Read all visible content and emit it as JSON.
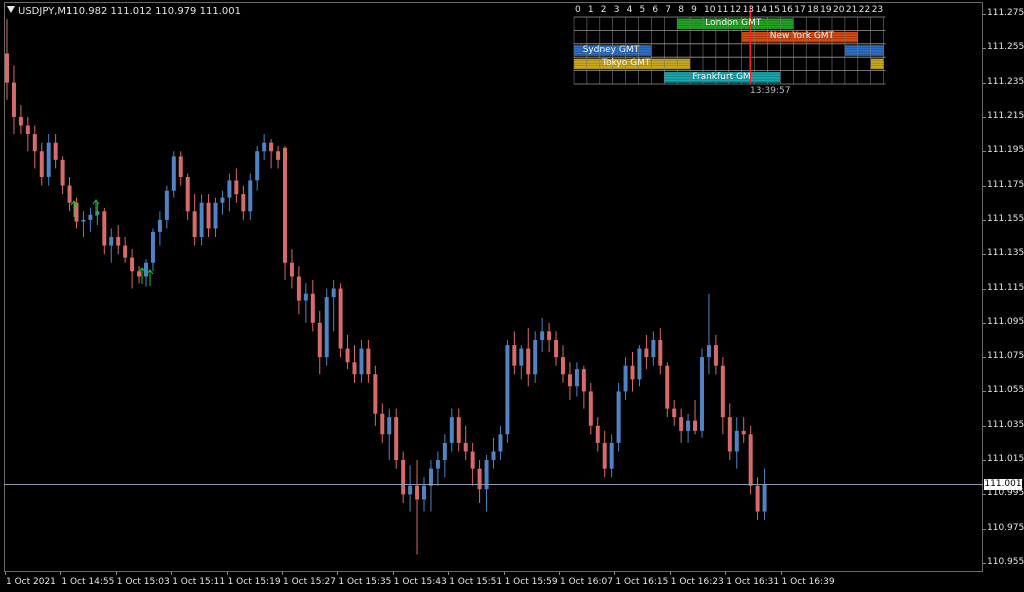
{
  "chart": {
    "symbol": "USDJPY,M1",
    "ohlc": "110.982 111.012 110.979 111.001",
    "current_price": "111.001",
    "price_labels": [
      "111.275",
      "111.255",
      "111.235",
      "111.215",
      "111.195",
      "111.175",
      "111.155",
      "111.135",
      "111.115",
      "111.095",
      "111.075",
      "111.055",
      "111.035",
      "111.015",
      "110.995",
      "110.975",
      "110.955"
    ],
    "time_labels": [
      "1 Oct 2021",
      "1 Oct 14:55",
      "1 Oct 15:03",
      "1 Oct 15:11",
      "1 Oct 15:19",
      "1 Oct 15:27",
      "1 Oct 15:35",
      "1 Oct 15:43",
      "1 Oct 15:51",
      "1 Oct 15:59",
      "1 Oct 16:07",
      "1 Oct 16:15",
      "1 Oct 16:23",
      "1 Oct 16:31",
      "1 Oct 16:39"
    ],
    "colors": {
      "bull": "#4f84c4",
      "bear": "#d96a6a",
      "bid_line": "#8c9ab0",
      "arrow": "#22c322"
    }
  },
  "sessions": {
    "hours": [
      "0",
      "1",
      "2",
      "3",
      "4",
      "5",
      "6",
      "7",
      "8",
      "9",
      "10",
      "11",
      "12",
      "13",
      "14",
      "15",
      "16",
      "17",
      "18",
      "19",
      "20",
      "21",
      "22",
      "23"
    ],
    "rows": [
      {
        "name": "London GMT",
        "color": "#1fa51f",
        "ranges": [
          [
            8,
            17
          ]
        ]
      },
      {
        "name": "New York GMT",
        "color": "#d34a12",
        "ranges": [
          [
            13,
            22
          ]
        ]
      },
      {
        "name": "Sydney GMT",
        "color": "#2d6fc4",
        "ranges": [
          [
            0,
            6
          ],
          [
            21,
            24
          ]
        ]
      },
      {
        "name": "Tokyo GMT",
        "color": "#c9a820",
        "ranges": [
          [
            0,
            9
          ],
          [
            23,
            24
          ]
        ]
      },
      {
        "name": "Frankfurt GM",
        "color": "#17a8b0",
        "ranges": [
          [
            7,
            16
          ]
        ]
      }
    ],
    "server_time": "13:39:57",
    "now_hour": 13.66
  },
  "candles": [
    [
      111.252,
      111.272,
      111.225,
      111.235
    ],
    [
      111.235,
      111.245,
      111.205,
      111.215
    ],
    [
      111.215,
      111.222,
      111.205,
      111.21
    ],
    [
      111.21,
      111.215,
      111.195,
      111.205
    ],
    [
      111.205,
      111.21,
      111.185,
      111.195
    ],
    [
      111.195,
      111.2,
      111.175,
      111.18
    ],
    [
      111.18,
      111.205,
      111.175,
      111.2
    ],
    [
      111.2,
      111.205,
      111.185,
      111.19
    ],
    [
      111.19,
      111.192,
      111.17,
      111.175
    ],
    [
      111.175,
      111.18,
      111.16,
      111.165
    ],
    [
      111.165,
      111.168,
      111.15,
      111.154
    ],
    [
      111.154,
      111.16,
      111.145,
      111.155
    ],
    [
      111.155,
      111.162,
      111.148,
      111.158
    ],
    [
      111.158,
      111.165,
      111.152,
      111.16
    ],
    [
      111.16,
      111.162,
      111.135,
      111.14
    ],
    [
      111.14,
      111.15,
      111.13,
      111.145
    ],
    [
      111.145,
      111.152,
      111.135,
      111.14
    ],
    [
      111.14,
      111.145,
      111.13,
      111.133
    ],
    [
      111.133,
      111.138,
      111.115,
      111.125
    ],
    [
      111.125,
      111.128,
      111.118,
      111.122
    ],
    [
      111.122,
      111.132,
      111.116,
      111.13
    ],
    [
      111.13,
      111.15,
      111.125,
      111.148
    ],
    [
      111.148,
      111.16,
      111.14,
      111.155
    ],
    [
      111.155,
      111.175,
      111.15,
      111.172
    ],
    [
      111.172,
      111.195,
      111.168,
      111.192
    ],
    [
      111.192,
      111.195,
      111.175,
      111.18
    ],
    [
      111.18,
      111.182,
      111.155,
      111.16
    ],
    [
      111.16,
      111.17,
      111.14,
      111.145
    ],
    [
      111.145,
      111.17,
      111.14,
      111.165
    ],
    [
      111.165,
      111.17,
      111.145,
      111.15
    ],
    [
      111.15,
      111.168,
      111.145,
      111.165
    ],
    [
      111.165,
      111.172,
      111.158,
      111.168
    ],
    [
      111.168,
      111.182,
      111.16,
      111.178
    ],
    [
      111.178,
      111.185,
      111.165,
      111.17
    ],
    [
      111.17,
      111.175,
      111.155,
      111.16
    ],
    [
      111.16,
      111.182,
      111.155,
      111.178
    ],
    [
      111.178,
      111.198,
      111.172,
      111.195
    ],
    [
      111.195,
      111.205,
      111.19,
      111.2
    ],
    [
      111.2,
      111.202,
      111.185,
      111.195
    ],
    [
      111.195,
      111.198,
      111.185,
      111.19
    ],
    [
      111.197,
      111.198,
      111.12,
      111.13
    ],
    [
      111.13,
      111.138,
      111.115,
      111.122
    ],
    [
      111.122,
      111.128,
      111.1,
      111.108
    ],
    [
      111.108,
      111.118,
      111.095,
      111.112
    ],
    [
      111.112,
      111.12,
      111.09,
      111.095
    ],
    [
      111.095,
      111.102,
      111.065,
      111.075
    ],
    [
      111.075,
      111.115,
      111.07,
      111.11
    ],
    [
      111.11,
      111.12,
      111.09,
      111.115
    ],
    [
      111.115,
      111.118,
      111.075,
      111.08
    ],
    [
      111.08,
      111.088,
      111.068,
      111.072
    ],
    [
      111.072,
      111.082,
      111.06,
      111.065
    ],
    [
      111.065,
      111.085,
      111.06,
      111.08
    ],
    [
      111.08,
      111.085,
      111.06,
      111.065
    ],
    [
      111.065,
      111.07,
      111.035,
      111.042
    ],
    [
      111.042,
      111.048,
      111.025,
      111.03
    ],
    [
      111.03,
      111.045,
      111.015,
      111.04
    ],
    [
      111.04,
      111.045,
      111.01,
      111.015
    ],
    [
      111.015,
      111.02,
      110.99,
      110.995
    ],
    [
      110.995,
      111.012,
      110.985,
      111.0
    ],
    [
      111.0,
      111.015,
      110.96,
      110.992
    ],
    [
      110.992,
      111.005,
      110.985,
      111.0
    ],
    [
      111.0,
      111.015,
      110.985,
      111.01
    ],
    [
      111.01,
      111.02,
      111.0,
      111.015
    ],
    [
      111.015,
      111.03,
      111.005,
      111.025
    ],
    [
      111.025,
      111.045,
      111.02,
      111.04
    ],
    [
      111.04,
      111.045,
      111.02,
      111.025
    ],
    [
      111.025,
      111.035,
      111.015,
      111.02
    ],
    [
      111.02,
      111.025,
      111.0,
      111.01
    ],
    [
      111.01,
      111.015,
      110.99,
      110.998
    ],
    [
      110.998,
      111.018,
      110.985,
      111.015
    ],
    [
      111.015,
      111.028,
      111.01,
      111.02
    ],
    [
      111.02,
      111.035,
      111.015,
      111.03
    ],
    [
      111.03,
      111.085,
      111.025,
      111.082
    ],
    [
      111.082,
      111.09,
      111.065,
      111.07
    ],
    [
      111.07,
      111.082,
      111.062,
      111.08
    ],
    [
      111.08,
      111.092,
      111.058,
      111.065
    ],
    [
      111.065,
      111.09,
      111.06,
      111.085
    ],
    [
      111.085,
      111.098,
      111.078,
      111.09
    ],
    [
      111.09,
      111.095,
      111.078,
      111.085
    ],
    [
      111.085,
      111.09,
      111.07,
      111.075
    ],
    [
      111.075,
      111.082,
      111.06,
      111.065
    ],
    [
      111.065,
      111.072,
      111.05,
      111.058
    ],
    [
      111.058,
      111.072,
      111.052,
      111.068
    ],
    [
      111.068,
      111.07,
      111.045,
      111.055
    ],
    [
      111.055,
      111.06,
      111.03,
      111.035
    ],
    [
      111.035,
      111.04,
      111.02,
      111.025
    ],
    [
      111.025,
      111.032,
      111.005,
      111.01
    ],
    [
      111.01,
      111.03,
      111.005,
      111.025
    ],
    [
      111.025,
      111.06,
      111.02,
      111.055
    ],
    [
      111.055,
      111.075,
      111.05,
      111.07
    ],
    [
      111.07,
      111.078,
      111.055,
      111.062
    ],
    [
      111.062,
      111.082,
      111.058,
      111.08
    ],
    [
      111.08,
      111.088,
      111.068,
      111.075
    ],
    [
      111.075,
      111.09,
      111.07,
      111.085
    ],
    [
      111.085,
      111.092,
      111.065,
      111.07
    ],
    [
      111.07,
      111.072,
      111.04,
      111.045
    ],
    [
      111.045,
      111.05,
      111.035,
      111.04
    ],
    [
      111.04,
      111.045,
      111.025,
      111.032
    ],
    [
      111.032,
      111.042,
      111.025,
      111.038
    ],
    [
      111.038,
      111.05,
      111.03,
      111.032
    ],
    [
      111.032,
      111.08,
      111.028,
      111.075
    ],
    [
      111.075,
      111.112,
      111.065,
      111.082
    ],
    [
      111.082,
      111.088,
      111.065,
      111.07
    ],
    [
      111.07,
      111.075,
      111.03,
      111.04
    ],
    [
      111.04,
      111.048,
      111.015,
      111.02
    ],
    [
      111.02,
      111.04,
      111.01,
      111.032
    ],
    [
      111.032,
      111.04,
      111.025,
      111.03
    ],
    [
      111.03,
      111.035,
      110.995,
      111.0
    ],
    [
      111.0,
      111.005,
      110.98,
      110.985
    ],
    [
      110.985,
      111.01,
      110.98,
      111.001
    ]
  ]
}
